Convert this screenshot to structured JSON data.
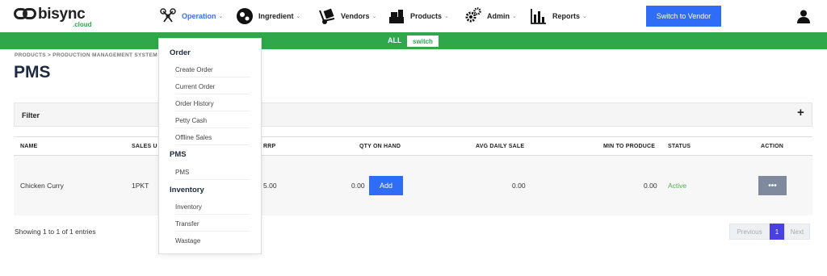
{
  "brand": {
    "name": "bisync",
    "sub": ".cloud",
    "accent": "#2ea84a"
  },
  "nav": [
    {
      "label": "Operation",
      "icon": "drone-icon",
      "active": true
    },
    {
      "label": "Ingredient",
      "icon": "ingredient-icon"
    },
    {
      "label": "Vendors",
      "icon": "hand-truck-icon"
    },
    {
      "label": "Products",
      "icon": "products-icon"
    },
    {
      "label": "Admin",
      "icon": "gears-icon"
    },
    {
      "label": "Reports",
      "icon": "bar-chart-icon"
    }
  ],
  "header": {
    "switch_vendor": "Switch to Vendor",
    "user_icon": "user-icon"
  },
  "banner": {
    "label": "ALL",
    "switch": "switch"
  },
  "breadcrumb": "PRODUCTS > PRODUCTION MANAGEMENT SYSTEM",
  "page": {
    "title": "PMS"
  },
  "filter": {
    "label": "Filter",
    "toggle": "+"
  },
  "table": {
    "columns": [
      "NAME",
      "SALES U",
      "RRP",
      "QTY ON HAND",
      "AVG DAILY SALE",
      "MIN TO PRODUCE",
      "STATUS",
      "ACTION"
    ],
    "rows": [
      {
        "name": "Chicken Curry",
        "sales_unit": "1PKT",
        "rrp": "5.00",
        "qty": "0.00",
        "add": "Add",
        "avg": "0.00",
        "min": "0.00",
        "status": "Active",
        "action": "•••"
      }
    ]
  },
  "footer": {
    "showing": "Showing 1 to 1 of 1 entries",
    "prev": "Previous",
    "page": "1",
    "next": "Next"
  },
  "dropdown": {
    "sections": [
      {
        "title": "Order",
        "items": [
          "Create Order",
          "Current Order",
          "Order History",
          "Petty Cash",
          "Offline Sales"
        ]
      },
      {
        "title": "PMS",
        "items": [
          "PMS"
        ]
      },
      {
        "title": "Inventory",
        "items": [
          "Inventory",
          "Transfer",
          "Wastage"
        ]
      }
    ]
  }
}
